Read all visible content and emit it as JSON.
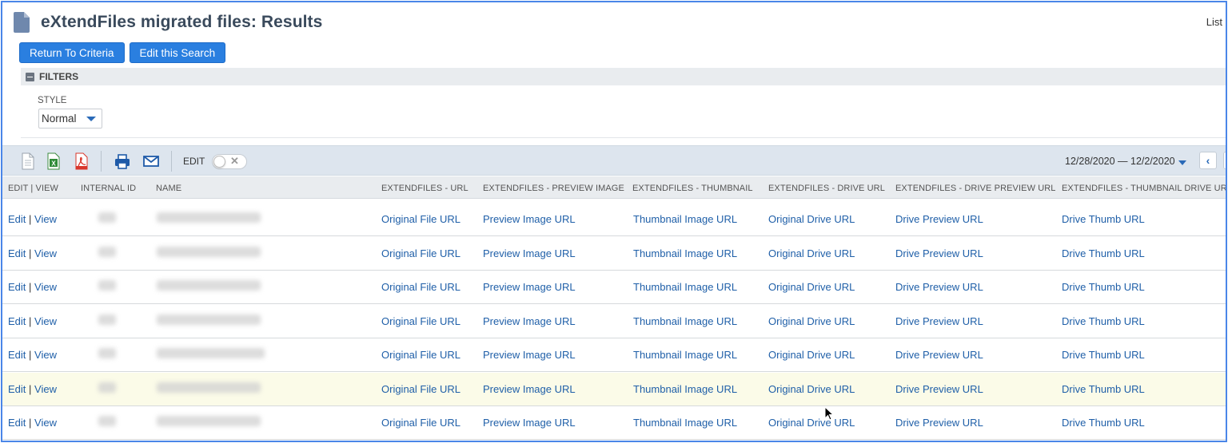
{
  "header": {
    "title": "eXtendFiles migrated files: Results",
    "list_link": "List"
  },
  "buttons": {
    "return_to_criteria": "Return To Criteria",
    "edit_this_search": "Edit this Search"
  },
  "filters": {
    "label": "FILTERS",
    "style_label": "STYLE",
    "style_value": "Normal"
  },
  "toolbar": {
    "edit_label": "EDIT",
    "edit_toggle_on": false,
    "date_range": "12/28/2020 — 12/2/2020",
    "icons": [
      "document-icon",
      "excel-icon",
      "pdf-icon",
      "print-icon",
      "email-icon"
    ]
  },
  "table": {
    "columns": [
      "EDIT | VIEW",
      "INTERNAL ID",
      "NAME",
      "EXTENDFILES - URL",
      "EXTENDFILES - PREVIEW IMAGE",
      "EXTENDFILES - THUMBNAIL",
      "EXTENDFILES - DRIVE URL",
      "EXTENDFILES - DRIVE PREVIEW URL",
      "EXTENDFILES - THUMBNAIL DRIVE URL"
    ],
    "edit_label": "Edit",
    "view_label": "View",
    "separator": "|",
    "rows": [
      {
        "url": "Original File URL",
        "preview": "Preview Image URL",
        "thumb": "Thumbnail Image URL",
        "drive": "Original Drive URL",
        "drive_preview": "Drive Preview URL",
        "drive_thumb": "Drive Thumb URL"
      },
      {
        "url": "Original File URL",
        "preview": "Preview Image URL",
        "thumb": "Thumbnail Image URL",
        "drive": "Original Drive URL",
        "drive_preview": "Drive Preview URL",
        "drive_thumb": "Drive Thumb URL"
      },
      {
        "url": "Original File URL",
        "preview": "Preview Image URL",
        "thumb": "Thumbnail Image URL",
        "drive": "Original Drive URL",
        "drive_preview": "Drive Preview URL",
        "drive_thumb": "Drive Thumb URL"
      },
      {
        "url": "Original File URL",
        "preview": "Preview Image URL",
        "thumb": "Thumbnail Image URL",
        "drive": "Original Drive URL",
        "drive_preview": "Drive Preview URL",
        "drive_thumb": "Drive Thumb URL"
      },
      {
        "url": "Original File URL",
        "preview": "Preview Image URL",
        "thumb": "Thumbnail Image URL",
        "drive": "Original Drive URL",
        "drive_preview": "Drive Preview URL",
        "drive_thumb": "Drive Thumb URL"
      },
      {
        "url": "Original File URL",
        "preview": "Preview Image URL",
        "thumb": "Thumbnail Image URL",
        "drive": "Original Drive URL",
        "drive_preview": "Drive Preview URL",
        "drive_thumb": "Drive Thumb URL"
      },
      {
        "url": "Original File URL",
        "preview": "Preview Image URL",
        "thumb": "Thumbnail Image URL",
        "drive": "Original Drive URL",
        "drive_preview": "Drive Preview URL",
        "drive_thumb": "Drive Thumb URL"
      }
    ]
  },
  "colors": {
    "accent": "#2a7fe0",
    "link": "#1f5fa8",
    "toolbar_bg": "#dde5ee",
    "header_bg": "#e9ecef",
    "highlight_row": "#fbfbe8",
    "frame_border": "#4a86e8"
  }
}
